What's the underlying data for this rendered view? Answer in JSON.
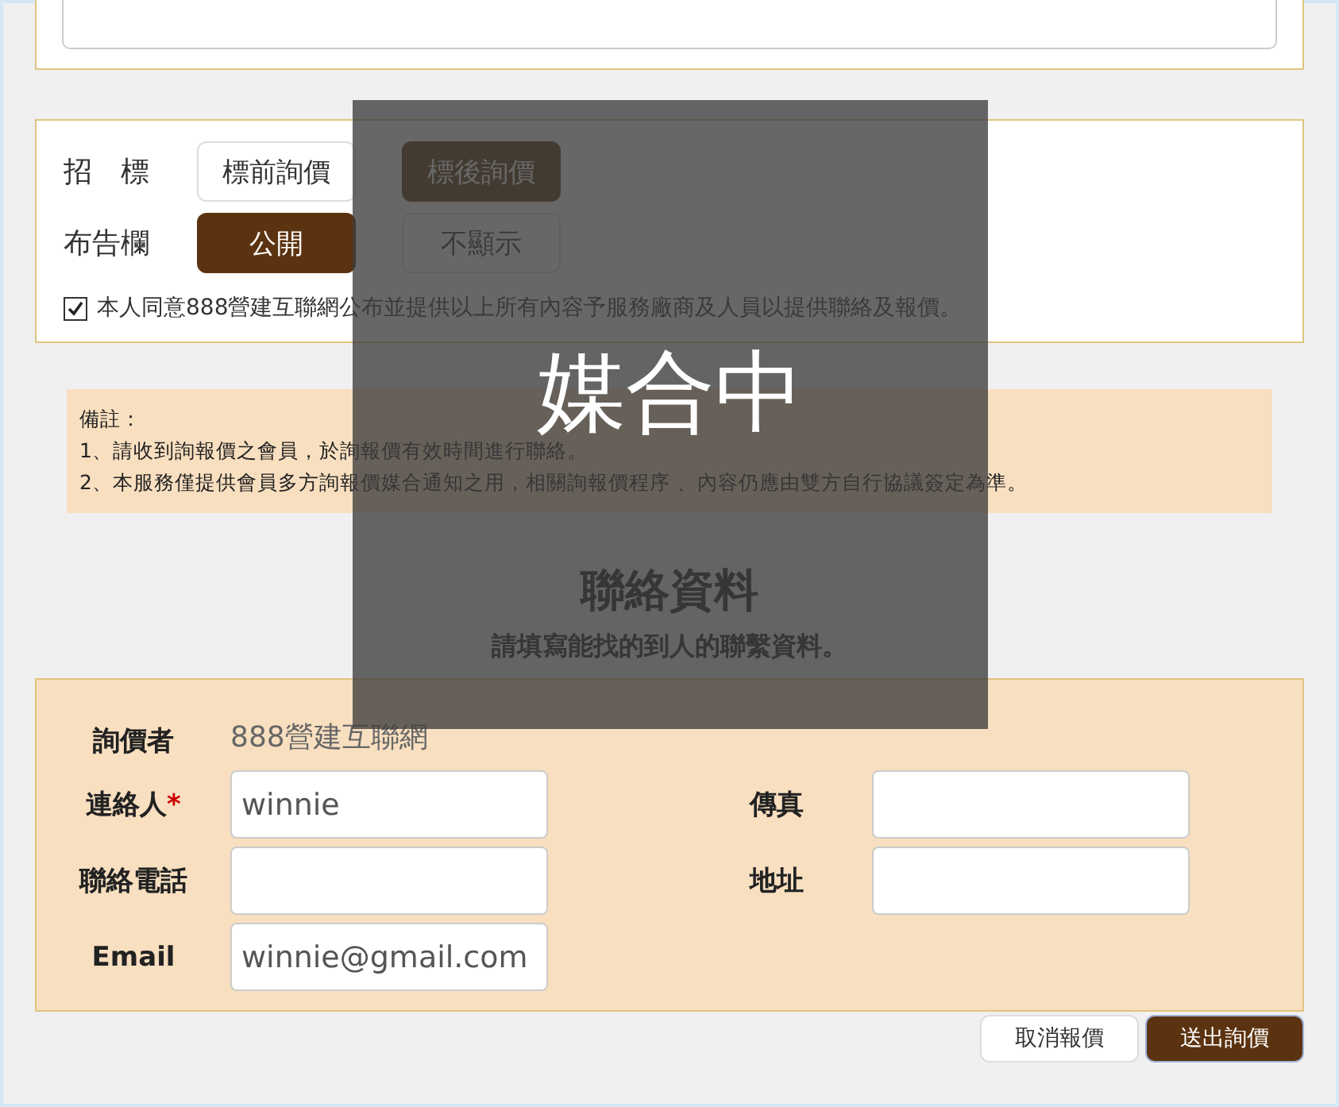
{
  "bidding": {
    "label": "招　標",
    "options": [
      {
        "label": "標前詢價",
        "selected": false
      },
      {
        "label": "標後詢價",
        "selected": true
      }
    ]
  },
  "notice_board": {
    "label": "布告欄",
    "options": [
      {
        "label": "公開",
        "selected": true
      },
      {
        "label": "不顯示",
        "selected": false
      }
    ]
  },
  "agreement": {
    "checked": true,
    "text": "本人同意888營建互聯網公布並提供以上所有內容予服務廠商及人員以提供聯絡及報價。"
  },
  "notes": {
    "title": "備註：",
    "lines": [
      "1、請收到詢報價之會員，於詢報價有效時間進行聯絡。",
      "2、本服務僅提供會員多方詢報價媒合通知之用，相關詢報價程序 、內容仍應由雙方自行協議簽定為準。"
    ]
  },
  "contact": {
    "title": "聯絡資料",
    "subtitle": "請填寫能找的到人的聯繫資料。",
    "inquirer_label": "詢價者",
    "inquirer": "888營建互聯網",
    "required_mark": "*",
    "fields": [
      {
        "label": "連絡人",
        "required": true,
        "value": "winnie"
      },
      {
        "label": "傳真",
        "required": false
      },
      {
        "label": "聯絡電話",
        "required": false
      },
      {
        "label": "地址",
        "required": false
      },
      {
        "label": "Email",
        "required": false,
        "value": "winnie@gmail.com"
      }
    ]
  },
  "buttons": [
    {
      "label": "取消報價",
      "kind": "secondary"
    },
    {
      "label": "送出詢價",
      "kind": "primary"
    }
  ],
  "overlay": {
    "text": "媒合中"
  }
}
